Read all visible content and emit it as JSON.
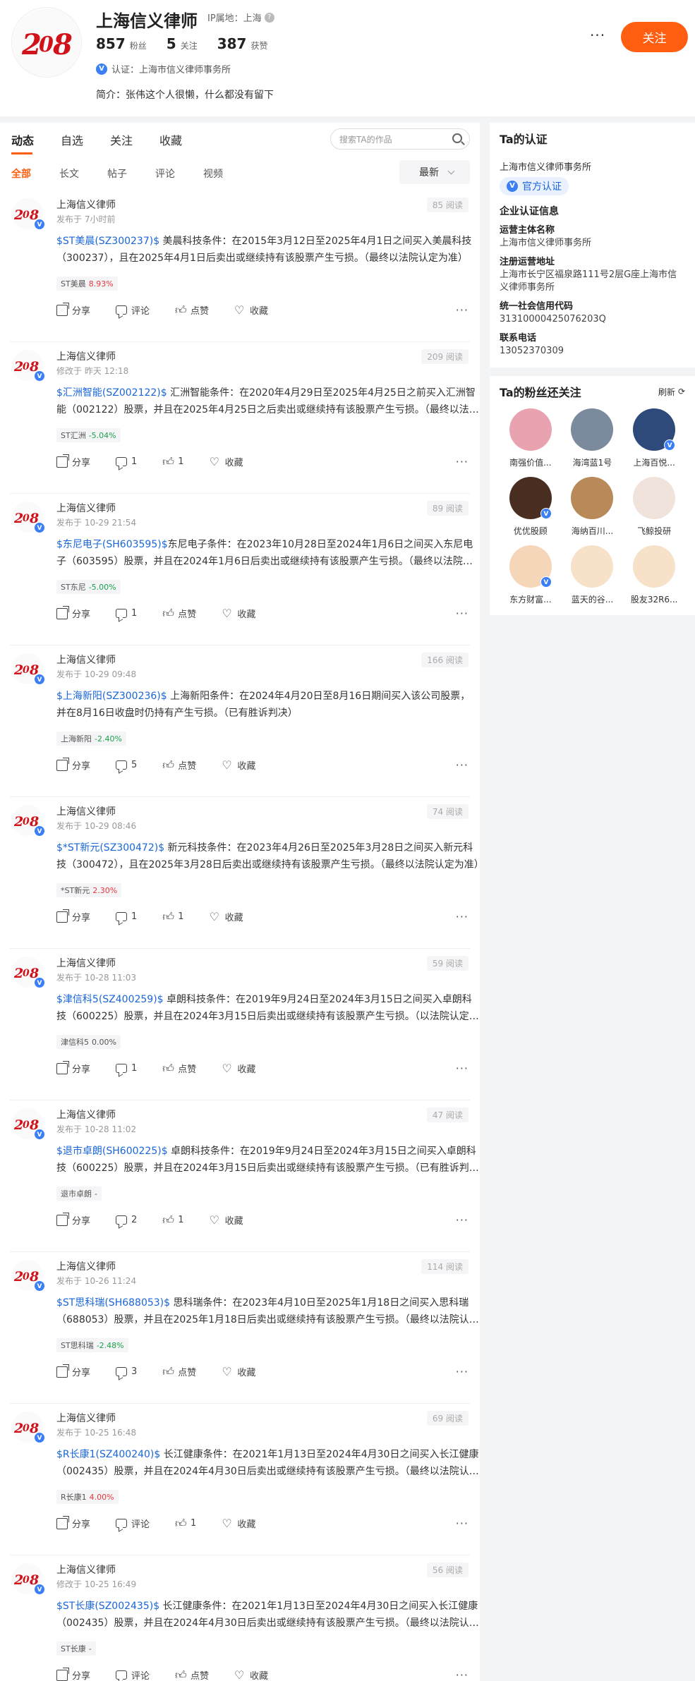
{
  "profile": {
    "name": "上海信义律师",
    "ip_label": "IP属地：上海",
    "stats": [
      {
        "num": "857",
        "label": "粉丝"
      },
      {
        "num": "5",
        "label": "关注"
      },
      {
        "num": "387",
        "label": "获赞"
      }
    ],
    "cert": "认证：上海市信义律师事务所",
    "bio": "简介：张伟这个人很懒，什么都没有留下",
    "follow_label": "关注",
    "more": "···"
  },
  "tabs": [
    "动态",
    "自选",
    "关注",
    "收藏"
  ],
  "search_placeholder": "搜索TA的作品",
  "subtabs": [
    "全部",
    "长文",
    "帖子",
    "评论",
    "视频"
  ],
  "sort_label": "最新",
  "posts": [
    {
      "author": "上海信义律师",
      "time": "发布于 7小时前",
      "reads": "85 阅读",
      "stock": "$ST美晨(SZ300237)$",
      "text": " 美晨科技条件：在2015年3月12日至2025年4月1日之间买入美晨科技（300237），且在2025年4月1日后卖出或继续持有该股票产生亏损。（最终以法院认定为准）",
      "tag_name": "ST美晨",
      "tag_change": "8.93%",
      "dir": "up",
      "share": "分享",
      "comment": "评论",
      "like": "点赞",
      "fav": "收藏"
    },
    {
      "author": "上海信义律师",
      "time": "修改于 昨天 12:18",
      "reads": "209 阅读",
      "stock": "$汇洲智能(SZ002122)$",
      "text": " 汇洲智能条件：在2020年4月29日至2025年4月25日之前买入汇洲智能（002122）股票，并且在2025年4月25日之后卖出或继续持有该股票产生亏损。（最终以法院认定为准）",
      "tag_name": "ST汇洲",
      "tag_change": "-5.04%",
      "dir": "down",
      "share": "分享",
      "comment": "1",
      "like": "1",
      "fav": "收藏"
    },
    {
      "author": "上海信义律师",
      "time": "发布于 10-29 21:54",
      "reads": "89 阅读",
      "stock": "$东尼电子(SH603595)$",
      "text": "东尼电子条件：在2023年10月28日至2024年1月6日之间买入东尼电子（603595）股票，并且在2024年1月6日后卖出或继续持有该股票产生亏损。（最终以法院认定为准）",
      "tag_name": "ST东尼",
      "tag_change": "-5.00%",
      "dir": "down",
      "share": "分享",
      "comment": "1",
      "like": "点赞",
      "fav": "收藏"
    },
    {
      "author": "上海信义律师",
      "time": "发布于 10-29 09:48",
      "reads": "166 阅读",
      "stock": "$上海新阳(SZ300236)$",
      "text": " 上海新阳条件：在2024年4月20日至8月16日期间买入该公司股票，并在8月16日收盘时仍持有产生亏损。（已有胜诉判决）",
      "tag_name": "上海新阳",
      "tag_change": "-2.40%",
      "dir": "down",
      "share": "分享",
      "comment": "5",
      "like": "点赞",
      "fav": "收藏"
    },
    {
      "author": "上海信义律师",
      "time": "发布于 10-29 08:46",
      "reads": "74 阅读",
      "stock": "$*ST新元(SZ300472)$",
      "text": " 新元科技条件：在2023年4月26日至2025年3月28日之间买入新元科技（300472），且在2025年3月28日后卖出或继续持有该股票产生亏损。（最终以法院认定为准）",
      "tag_name": "*ST新元",
      "tag_change": "2.30%",
      "dir": "up",
      "share": "分享",
      "comment": "1",
      "like": "1",
      "fav": "收藏"
    },
    {
      "author": "上海信义律师",
      "time": "发布于 10-28 11:03",
      "reads": "59 阅读",
      "stock": "$津信科5(SZ400259)$",
      "text": " 卓朗科技条件：在2019年9月24日至2024年3月15日之间买入卓朗科技（600225）股票，并且在2024年3月15日后卖出或继续持有该股票产生亏损。（以法院认定为准）",
      "tag_name": "津信科5",
      "tag_change": "0.00%",
      "dir": "flat",
      "share": "分享",
      "comment": "1",
      "like": "点赞",
      "fav": "收藏"
    },
    {
      "author": "上海信义律师",
      "time": "发布于 10-28 11:02",
      "reads": "47 阅读",
      "stock": "$退市卓朗(SH600225)$",
      "text": " 卓朗科技条件：在2019年9月24日至2024年3月15日之间买入卓朗科技（600225）股票，并且在2024年3月15日后卖出或继续持有该股票产生亏损。（已有胜诉判决）",
      "tag_name": "退市卓朗",
      "tag_change": "-",
      "dir": "flat",
      "share": "分享",
      "comment": "2",
      "like": "1",
      "fav": "收藏"
    },
    {
      "author": "上海信义律师",
      "time": "发布于 10-26 11:24",
      "reads": "114 阅读",
      "stock": "$ST思科瑞(SH688053)$",
      "text": " 思科瑞条件：在2023年4月10日至2025年1月18日之间买入思科瑞（688053）股票，并且在2025年1月18日后卖出或继续持有该股票产生亏损。（最终以法院认定为准）",
      "tag_name": "ST思科瑞",
      "tag_change": "-2.48%",
      "dir": "down",
      "share": "分享",
      "comment": "3",
      "like": "点赞",
      "fav": "收藏"
    },
    {
      "author": "上海信义律师",
      "time": "发布于 10-25 16:48",
      "reads": "69 阅读",
      "stock": "$R长康1(SZ400240)$",
      "text": " 长江健康条件：在2021年1月13日至2024年4月30日之间买入长江健康（002435）股票，并且在2024年4月30日后卖出或继续持有该股票产生亏损。（最终以法院认定为准）",
      "tag_name": "R长康1",
      "tag_change": "4.00%",
      "dir": "up",
      "share": "分享",
      "comment": "评论",
      "like": "1",
      "fav": "收藏"
    },
    {
      "author": "上海信义律师",
      "time": "修改于 10-25 16:49",
      "reads": "56 阅读",
      "stock": "$ST长康(SZ002435)$",
      "text": " 长江健康条件：在2021年1月13日至2024年4月30日之间买入长江健康（002435）股票，并且在2024年4月30日后卖出或继续持有该股票产生亏损。（最终以法院认定为准）",
      "tag_name": "ST长康",
      "tag_change": "-",
      "dir": "flat",
      "share": "分享",
      "comment": "评论",
      "like": "点赞",
      "fav": "收藏"
    }
  ],
  "sidebar": {
    "cert_title": "Ta的认证",
    "cert_org": "上海市信义律师事务所",
    "official_label": "官方认证",
    "enterprise_title": "企业认证信息",
    "fields": [
      {
        "k": "运营主体名称",
        "v": "上海市信义律师事务所"
      },
      {
        "k": "注册运营地址",
        "v": "上海市长宁区福泉路111号2层G座上海市信义律师事务所"
      },
      {
        "k": "统一社会信用代码",
        "v": "31310000425076203Q"
      },
      {
        "k": "联系电话",
        "v": "13052370309"
      }
    ],
    "fans_title": "Ta的粉丝还关注",
    "refresh_label": "刷新",
    "fans": [
      {
        "name": "南强价值...",
        "color": "#e9a3b0",
        "v": false
      },
      {
        "name": "海湾蓝1号",
        "color": "#7b8a9c",
        "v": false
      },
      {
        "name": "上海百悦...",
        "color": "#2d4a7a",
        "v": true
      },
      {
        "name": "优优股顾",
        "color": "#4a2e22",
        "v": true
      },
      {
        "name": "海纳百川...",
        "color": "#b88a5a",
        "v": false
      },
      {
        "name": "飞鲸投研",
        "color": "#f0e3dc",
        "v": false
      },
      {
        "name": "东方财富...",
        "color": "#f5d6b8",
        "v": true
      },
      {
        "name": "蓝天的谷...",
        "color": "#f7e1c9",
        "v": false
      },
      {
        "name": "股友32R6...",
        "color": "#f7e1c9",
        "v": false
      }
    ]
  }
}
